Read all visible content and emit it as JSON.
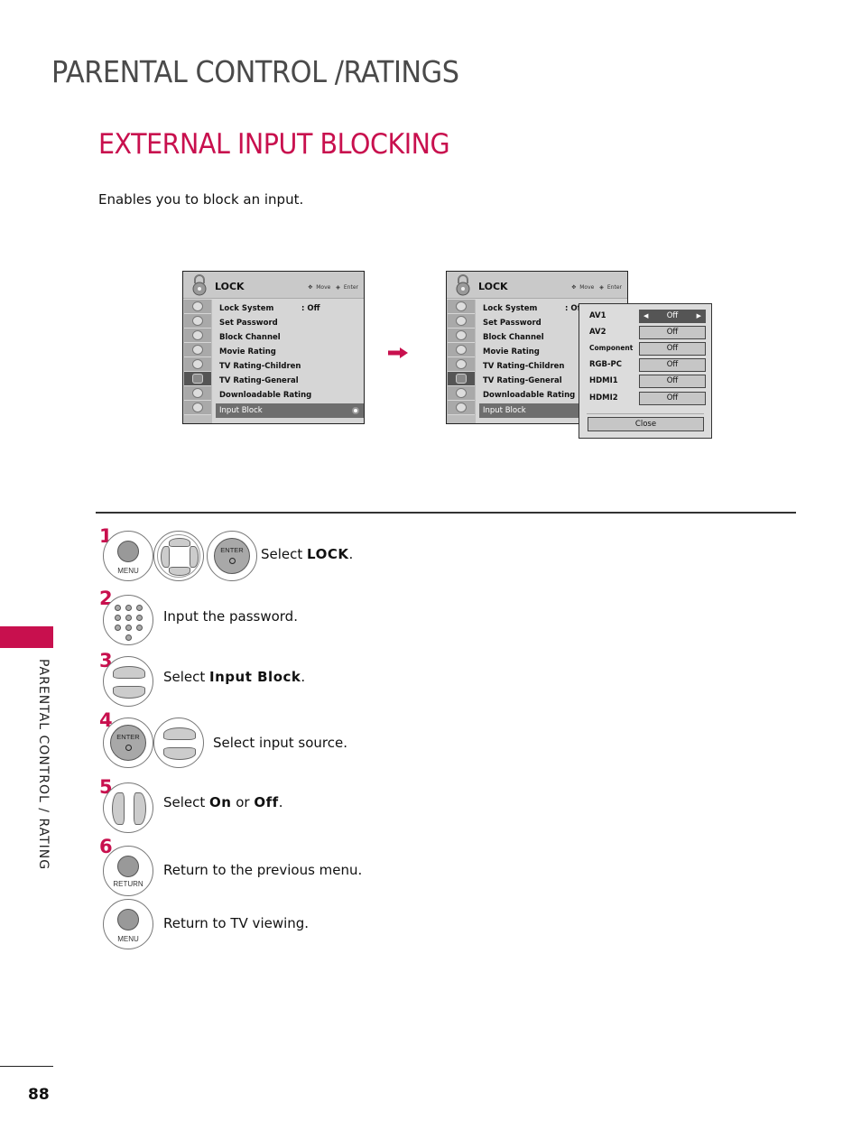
{
  "header": {
    "title": "PARENTAL CONTROL /RATINGS",
    "section_title": "EXTERNAL INPUT BLOCKING",
    "description": "Enables you to block an input."
  },
  "osd_left": {
    "title": "LOCK",
    "hint_move": "Move",
    "hint_enter": "Enter",
    "items": [
      {
        "label": "Lock System",
        "value": ": Off"
      },
      {
        "label": "Set Password",
        "value": ""
      },
      {
        "label": "Block Channel",
        "value": ""
      },
      {
        "label": "Movie Rating",
        "value": ""
      },
      {
        "label": "TV Rating-Children",
        "value": ""
      },
      {
        "label": "TV Rating-General",
        "value": ""
      },
      {
        "label": "Downloadable Rating",
        "value": ""
      },
      {
        "label": "Input Block",
        "value": ""
      }
    ],
    "selected_index": 7,
    "side_icons": [
      "picture-icon",
      "tv-icon",
      "audio-icon",
      "time-icon",
      "option-icon",
      "lock-icon",
      "input-icon",
      "usb-icon"
    ]
  },
  "osd_right": {
    "title": "LOCK",
    "hint_move": "Move",
    "hint_enter": "Enter",
    "items": [
      {
        "label": "Lock System",
        "value": ": Of"
      },
      {
        "label": "Set Password",
        "value": ""
      },
      {
        "label": "Block Channel",
        "value": ""
      },
      {
        "label": "Movie Rating",
        "value": ""
      },
      {
        "label": "TV Rating-Children",
        "value": ""
      },
      {
        "label": "TV Rating-General",
        "value": ""
      },
      {
        "label": "Downloadable Rating",
        "value": ""
      },
      {
        "label": "Input Block",
        "value": ""
      }
    ]
  },
  "input_block_popup": {
    "rows": [
      {
        "label": "AV1",
        "value": "Off",
        "active": true
      },
      {
        "label": "AV2",
        "value": "Off"
      },
      {
        "label": "Component",
        "value": "Off"
      },
      {
        "label": "RGB-PC",
        "value": "Off"
      },
      {
        "label": "HDMI1",
        "value": "Off"
      },
      {
        "label": "HDMI2",
        "value": "Off"
      }
    ],
    "close_label": "Close"
  },
  "steps": [
    {
      "num": "1",
      "text_pre": "Select ",
      "text_bold": "LOCK",
      "text_post": "."
    },
    {
      "num": "2",
      "text_pre": "Input the password.",
      "text_bold": "",
      "text_post": ""
    },
    {
      "num": "3",
      "text_pre": "Select ",
      "text_bold": "Input Block",
      "text_post": "."
    },
    {
      "num": "4",
      "text_pre": "Select input source.",
      "text_bold": "",
      "text_post": ""
    },
    {
      "num": "5",
      "text_pre": "Select ",
      "text_bold": "On",
      "text_mid": " or ",
      "text_bold2": "Off",
      "text_post": "."
    },
    {
      "num": "6",
      "text_pre": "Return to the previous menu.",
      "text_bold": "",
      "text_post": ""
    },
    {
      "num": "",
      "text_pre": "Return to TV viewing.",
      "text_bold": "",
      "text_post": ""
    }
  ],
  "buttons": {
    "menu": "MENU",
    "enter": "ENTER",
    "return": "RETURN"
  },
  "side_tab": "PARENTAL CONTROL / RATING",
  "page_number": "88",
  "colors": {
    "accent": "#c8104e",
    "title_gray": "#4a4a4a"
  }
}
